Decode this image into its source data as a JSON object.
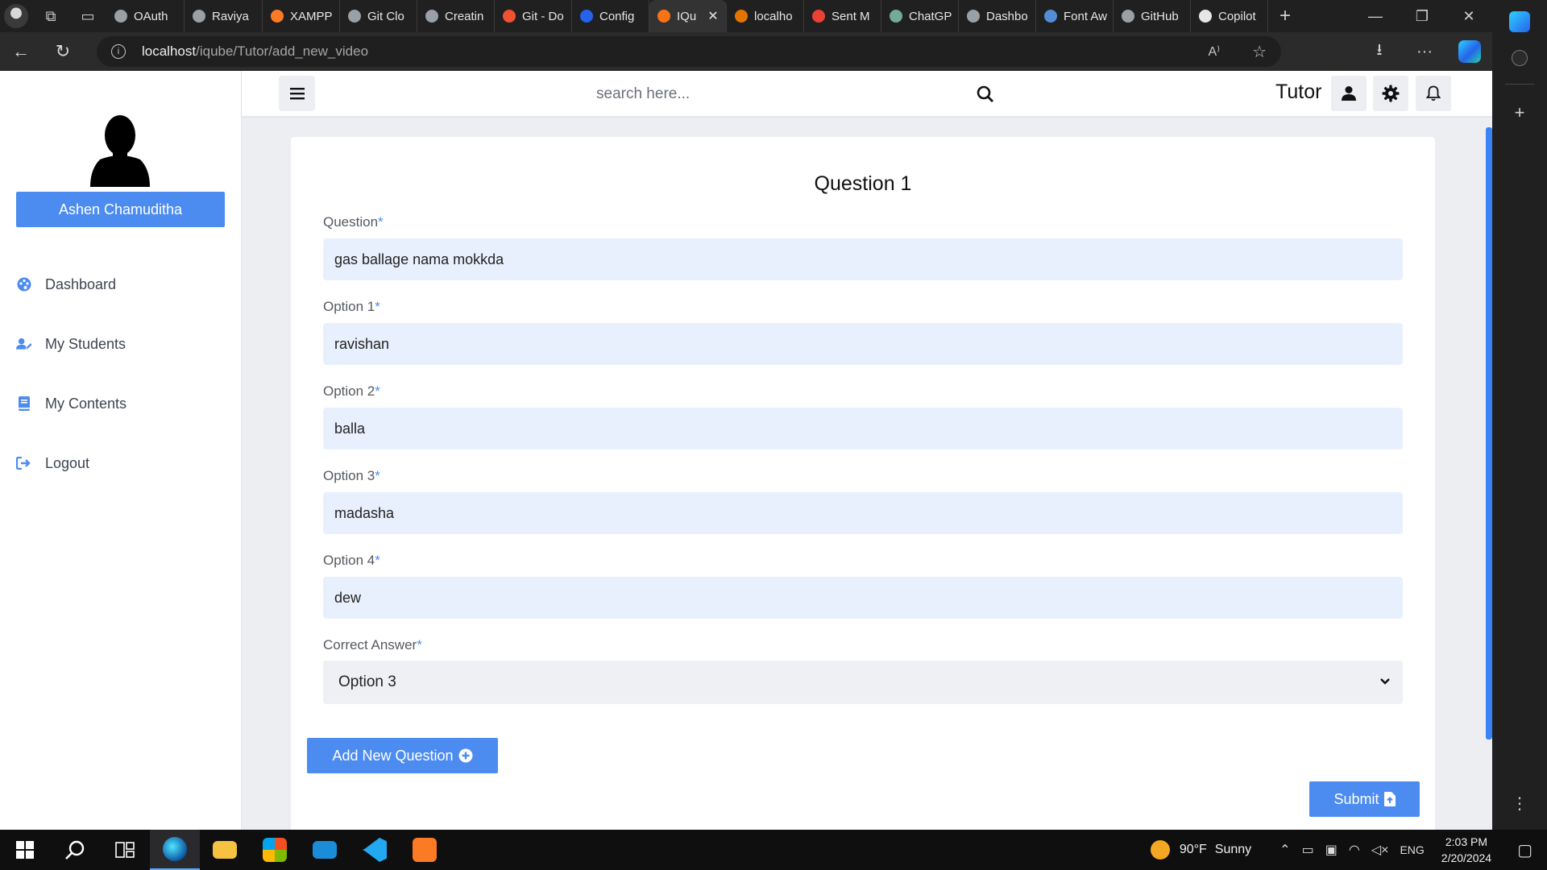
{
  "browser": {
    "tabs": [
      {
        "label": "OAuth",
        "color": "#9aa0a6"
      },
      {
        "label": "Raviya",
        "color": "#9aa0a6"
      },
      {
        "label": "XAMPP",
        "color": "#fb7a24"
      },
      {
        "label": "Git Clo",
        "color": "#9aa0a6"
      },
      {
        "label": "Creatin",
        "color": "#9aa0a6"
      },
      {
        "label": "Git - Do",
        "color": "#f05133"
      },
      {
        "label": "Config",
        "color": "#2563eb"
      },
      {
        "label": "IQu",
        "color": "#f97316",
        "active": true
      },
      {
        "label": "localho",
        "color": "#e37400"
      },
      {
        "label": "Sent M",
        "color": "#ea4335"
      },
      {
        "label": "ChatGP",
        "color": "#74aa9c"
      },
      {
        "label": "Dashbo",
        "color": "#9aa0a6"
      },
      {
        "label": "Font Aw",
        "color": "#538dd7"
      },
      {
        "label": "GitHub",
        "color": "#9aa0a6"
      },
      {
        "label": "Copilot",
        "color": "#e6e6e6"
      }
    ],
    "address": {
      "host": "localhost",
      "path": "/iqube/Tutor/add_new_video"
    }
  },
  "sidebar": {
    "user_name": "Ashen Chamuditha",
    "items": [
      {
        "label": "Dashboard",
        "icon": "palette-icon"
      },
      {
        "label": "My Students",
        "icon": "user-edit-icon"
      },
      {
        "label": "My Contents",
        "icon": "book-icon"
      },
      {
        "label": "Logout",
        "icon": "logout-icon"
      }
    ]
  },
  "topbar": {
    "search_placeholder": "search here...",
    "role": "Tutor"
  },
  "form": {
    "heading": "Question 1",
    "fields": [
      {
        "label": "Question",
        "value": "gas ballage nama mokkda"
      },
      {
        "label": "Option 1",
        "value": "ravishan"
      },
      {
        "label": "Option 2",
        "value": "balla"
      },
      {
        "label": "Option 3",
        "value": "madasha"
      },
      {
        "label": "Option 4",
        "value": "dew"
      }
    ],
    "correct_label": "Correct Answer",
    "correct_value": "Option 3",
    "required_mark": "*",
    "add_button": "Add New Question",
    "submit_button": "Submit"
  },
  "taskbar": {
    "weather_temp": "90°F",
    "weather_desc": "Sunny",
    "language": "ENG",
    "time": "2:03 PM",
    "date": "2/20/2024"
  },
  "colors": {
    "accent": "#4c8cf0",
    "input_bg": "#e8f0fe"
  }
}
